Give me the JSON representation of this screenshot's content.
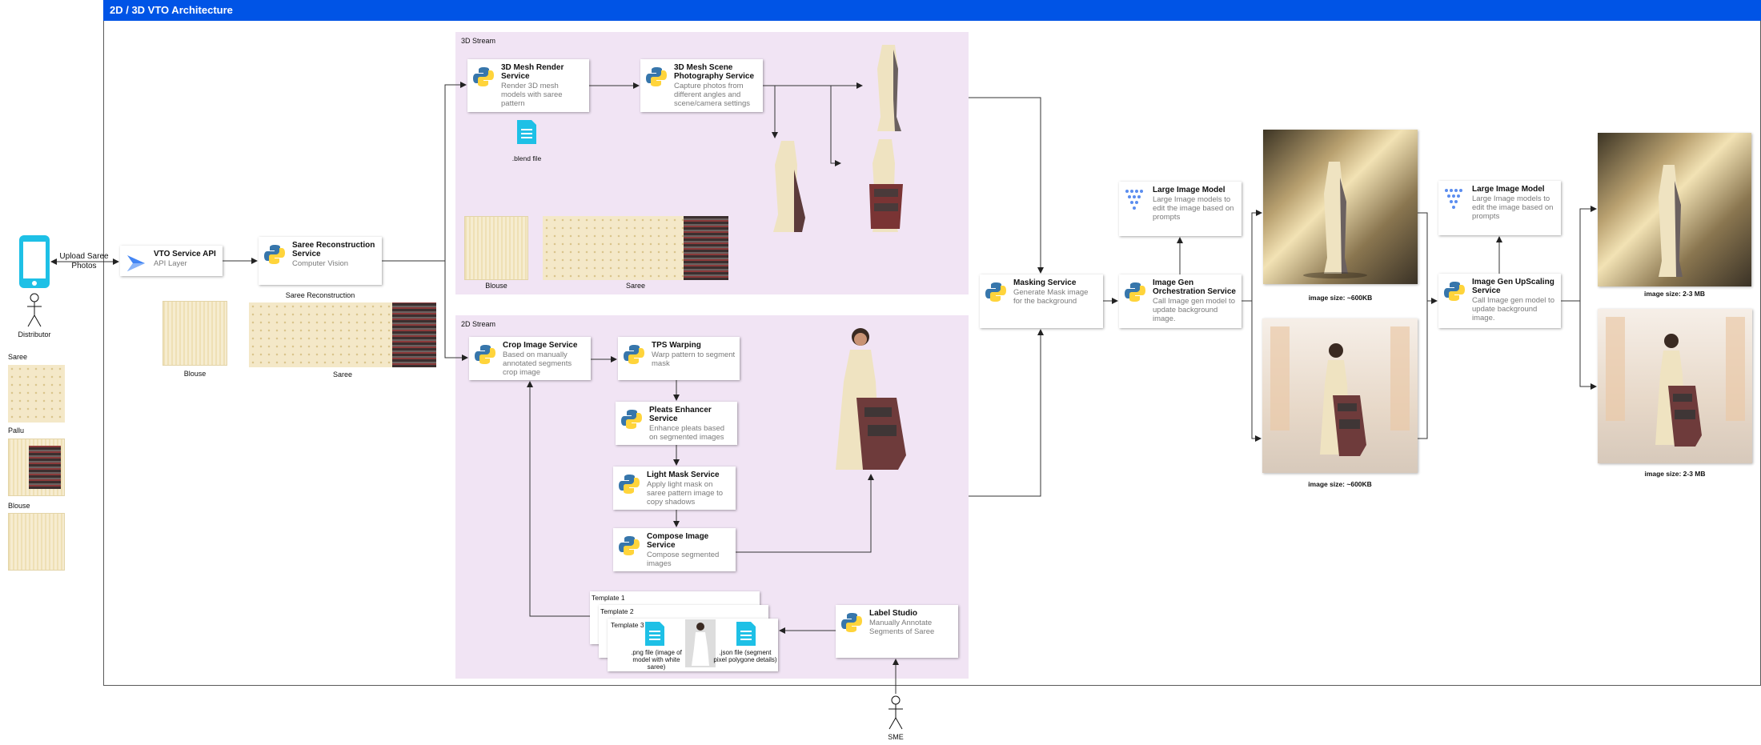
{
  "title": "2D / 3D VTO Architecture",
  "colors": {
    "accent": "#0054e6",
    "stream_bg": "#f1e4f4",
    "file_icon": "#1ec0e6"
  },
  "actors": {
    "distributor": "Distributor",
    "sme": "SME"
  },
  "upload_label": "Upload Saree Photos",
  "left_panel": {
    "saree": "Saree",
    "pallu": "Pallu",
    "blouse": "Blouse"
  },
  "vto_api": {
    "title": "VTO Service API",
    "subtitle": "API Layer"
  },
  "saree_recon": {
    "title": "Saree Reconstruction Service",
    "subtitle": "Computer Vision",
    "caption": "Saree Reconstruction",
    "blouse": "Blouse",
    "saree": "Saree"
  },
  "stream_3d": {
    "label": "3D Stream",
    "mesh_render": {
      "title": "3D Mesh Render Service",
      "subtitle": "Render 3D mesh models with saree pattern"
    },
    "mesh_scene": {
      "title": "3D Mesh Scene Photography Service",
      "subtitle": "Capture photos from different angles and scene/camera settings"
    },
    "blend_file": ".blend file",
    "blouse": "Blouse",
    "saree": "Saree"
  },
  "stream_2d": {
    "label": "2D Stream",
    "crop": {
      "title": "Crop Image Service",
      "subtitle": "Based on manually annotated segments crop image"
    },
    "tps": {
      "title": "TPS Warping",
      "subtitle": "Warp pattern to segment mask"
    },
    "pleats": {
      "title": "Pleats Enhancer Service",
      "subtitle": "Enhance pleats based on segmented images"
    },
    "light_mask": {
      "title": "Light Mask Service",
      "subtitle": "Apply light mask on saree pattern image to copy shadows"
    },
    "compose": {
      "title": "Compose Image Service",
      "subtitle": "Compose segmented images"
    },
    "templates": [
      "Template 1",
      "Template 2",
      "Template 3"
    ],
    "png_file": ".png file (image of model with white saree)",
    "json_file": ".json file (segment pixel polygone details)",
    "label_studio": {
      "title": "Label Studio",
      "subtitle": "Manually Annotate Segments of Saree"
    }
  },
  "masking": {
    "title": "Masking Service",
    "subtitle": "Generate Mask image for the background"
  },
  "lim1": {
    "title": "Large Image Model",
    "subtitle": "Large Image models to edit the image based on prompts"
  },
  "imggen": {
    "title": "Image Gen Orchestration Service",
    "subtitle": "Call Image gen model to update background image."
  },
  "lim2": {
    "title": "Large Image Model",
    "subtitle": "Large Image models to edit the image based on prompts"
  },
  "upscale": {
    "title": "Image Gen UpScaling Service",
    "subtitle": "Call Image gen model to update background image."
  },
  "size_labels": {
    "gen_top": "image size: ~600KB",
    "gen_bottom": "image size: ~600KB",
    "up_top": "image size: 2-3 MB",
    "up_bottom": "image size: 2-3 MB"
  }
}
